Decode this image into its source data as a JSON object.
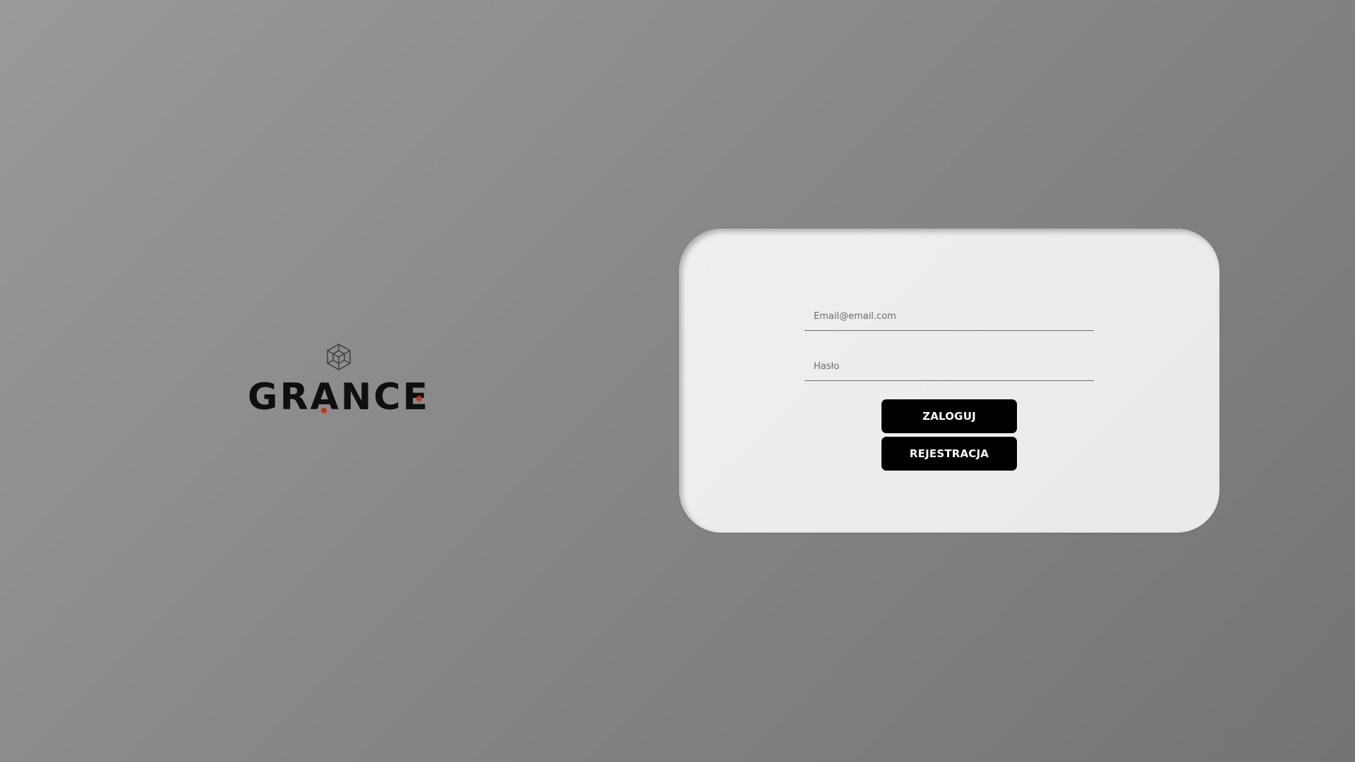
{
  "brand": {
    "name": "GRANCE",
    "icon": "cube-icon",
    "accent_color": "#c8321e",
    "text_color": "#0f0f0f"
  },
  "login_form": {
    "email_placeholder": "Email@email.com",
    "password_placeholder": "Hasło",
    "login_label": "ZALOGUJ",
    "register_label": "REJESTRACJA"
  },
  "colors": {
    "card_background": "#ececec",
    "button_background": "#000000",
    "button_text": "#ffffff"
  }
}
